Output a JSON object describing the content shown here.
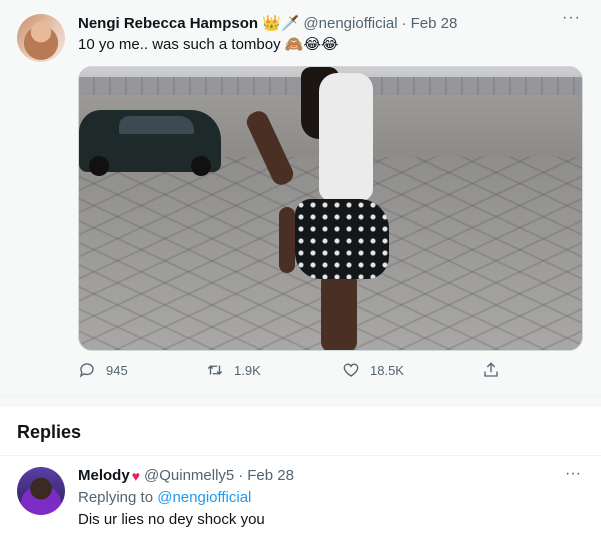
{
  "tweet": {
    "author_name": "Nengi Rebecca Hampson",
    "author_badge": "👑🗡️",
    "author_handle": "@nengiofficial",
    "separator": "·",
    "date": "Feb 28",
    "more_label": "···",
    "text": "10 yo me.. was such a tomboy 🙈😂😂",
    "actions": {
      "replies": "945",
      "retweets": "1.9K",
      "likes": "18.5K"
    }
  },
  "replies_section": {
    "title": "Replies"
  },
  "reply": {
    "author_name": "Melody",
    "author_badge": "♥",
    "author_handle": "@Quinmelly5",
    "separator": "·",
    "date": "Feb 28",
    "more_label": "···",
    "replying_prefix": "Replying to ",
    "replying_to": "@nengiofficial",
    "text": "Dis ur lies no dey shock you"
  },
  "colors": {
    "text_primary": "#0f1419",
    "text_secondary": "#536471",
    "link": "#1d9bf0",
    "background": "#f7f9f9"
  },
  "icons": [
    "reply-icon",
    "retweet-icon",
    "like-icon",
    "share-icon",
    "more-icon"
  ]
}
